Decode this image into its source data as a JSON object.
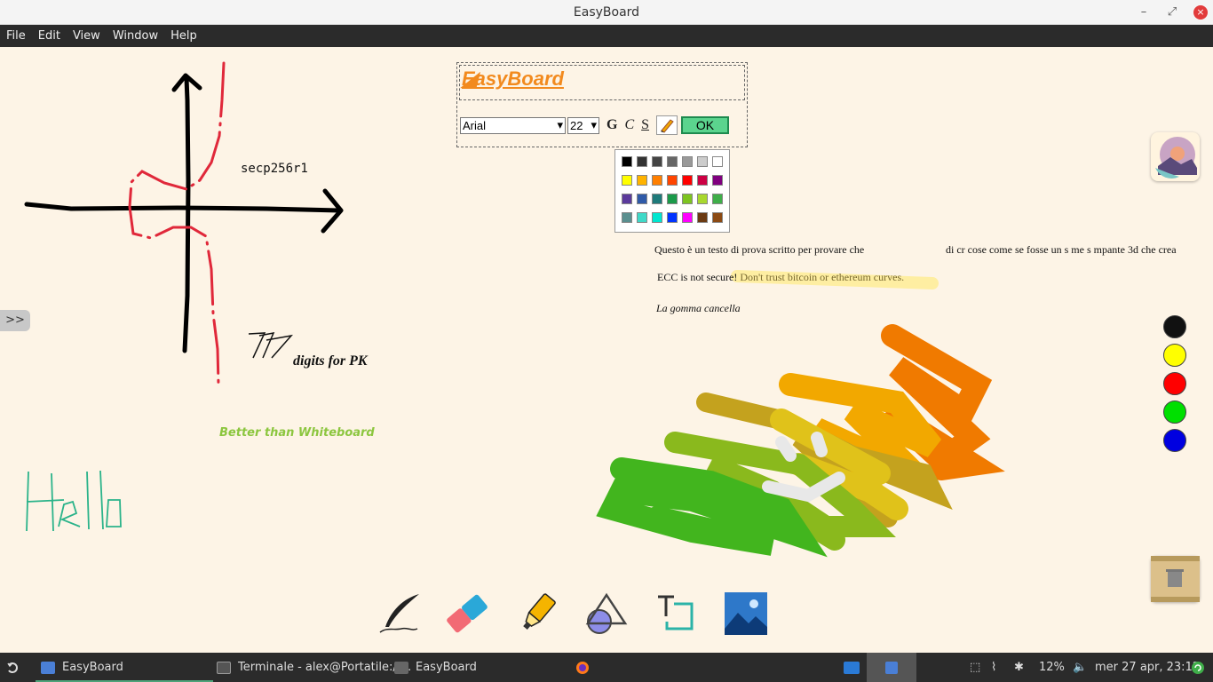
{
  "window": {
    "title": "EasyBoard",
    "minimize": "–",
    "maximize": "⤢",
    "close": "×"
  },
  "menu": [
    "File",
    "Edit",
    "View",
    "Window",
    "Help"
  ],
  "editor": {
    "text": "EasyBoard",
    "font": "Arial",
    "size": "22",
    "bold": "G",
    "italic": "C",
    "underline": "S",
    "ok": "OK"
  },
  "palette": [
    "#000000",
    "#333333",
    "#444444",
    "#666666",
    "#999999",
    "#cccccc",
    "#ffffff",
    "#ffff00",
    "#ffb300",
    "#ff7f00",
    "#ff4500",
    "#ff0000",
    "#cc0044",
    "#800080",
    "#5b3a9c",
    "#2f5aa8",
    "#1e7a7a",
    "#1b9a4a",
    "#7dc421",
    "#a8d82e",
    "#3fae4a",
    "#5a8f8f",
    "#3fd9c8",
    "#00e6d0",
    "#0033ff",
    "#ff00ff",
    "#6b3a12",
    "#8b4a14"
  ],
  "canvas_text": {
    "curve_name": "secp256r1",
    "digits_num": "77",
    "digits": "digits for PK",
    "better": "Better than Whiteboard",
    "hello": "Hello",
    "test_text": "Questo è un testo di prova scritto per provare che",
    "test_text2": "di cr     cose come se fosse un  s    me s     mpante 3d che crea",
    "ecc_a": "ECC is not secure!",
    "ecc_b": "Don't trust bitcoin or ethereum curves.",
    "gomma": "La gomma cancella"
  },
  "left_tab": ">>",
  "quick_colors": [
    "#111111",
    "#ffff00",
    "#ff0000",
    "#00e000",
    "#0000e0"
  ],
  "tools": [
    "pen-tool",
    "eraser-tool",
    "highlighter-tool",
    "shapes-tool",
    "text-tool",
    "image-tool"
  ],
  "taskbar": {
    "items": [
      "EasyBoard",
      "Terminale - alex@Portatile:/r...",
      "EasyBoard"
    ],
    "battery": "12%",
    "clock": "mer 27 apr, 23:12"
  }
}
